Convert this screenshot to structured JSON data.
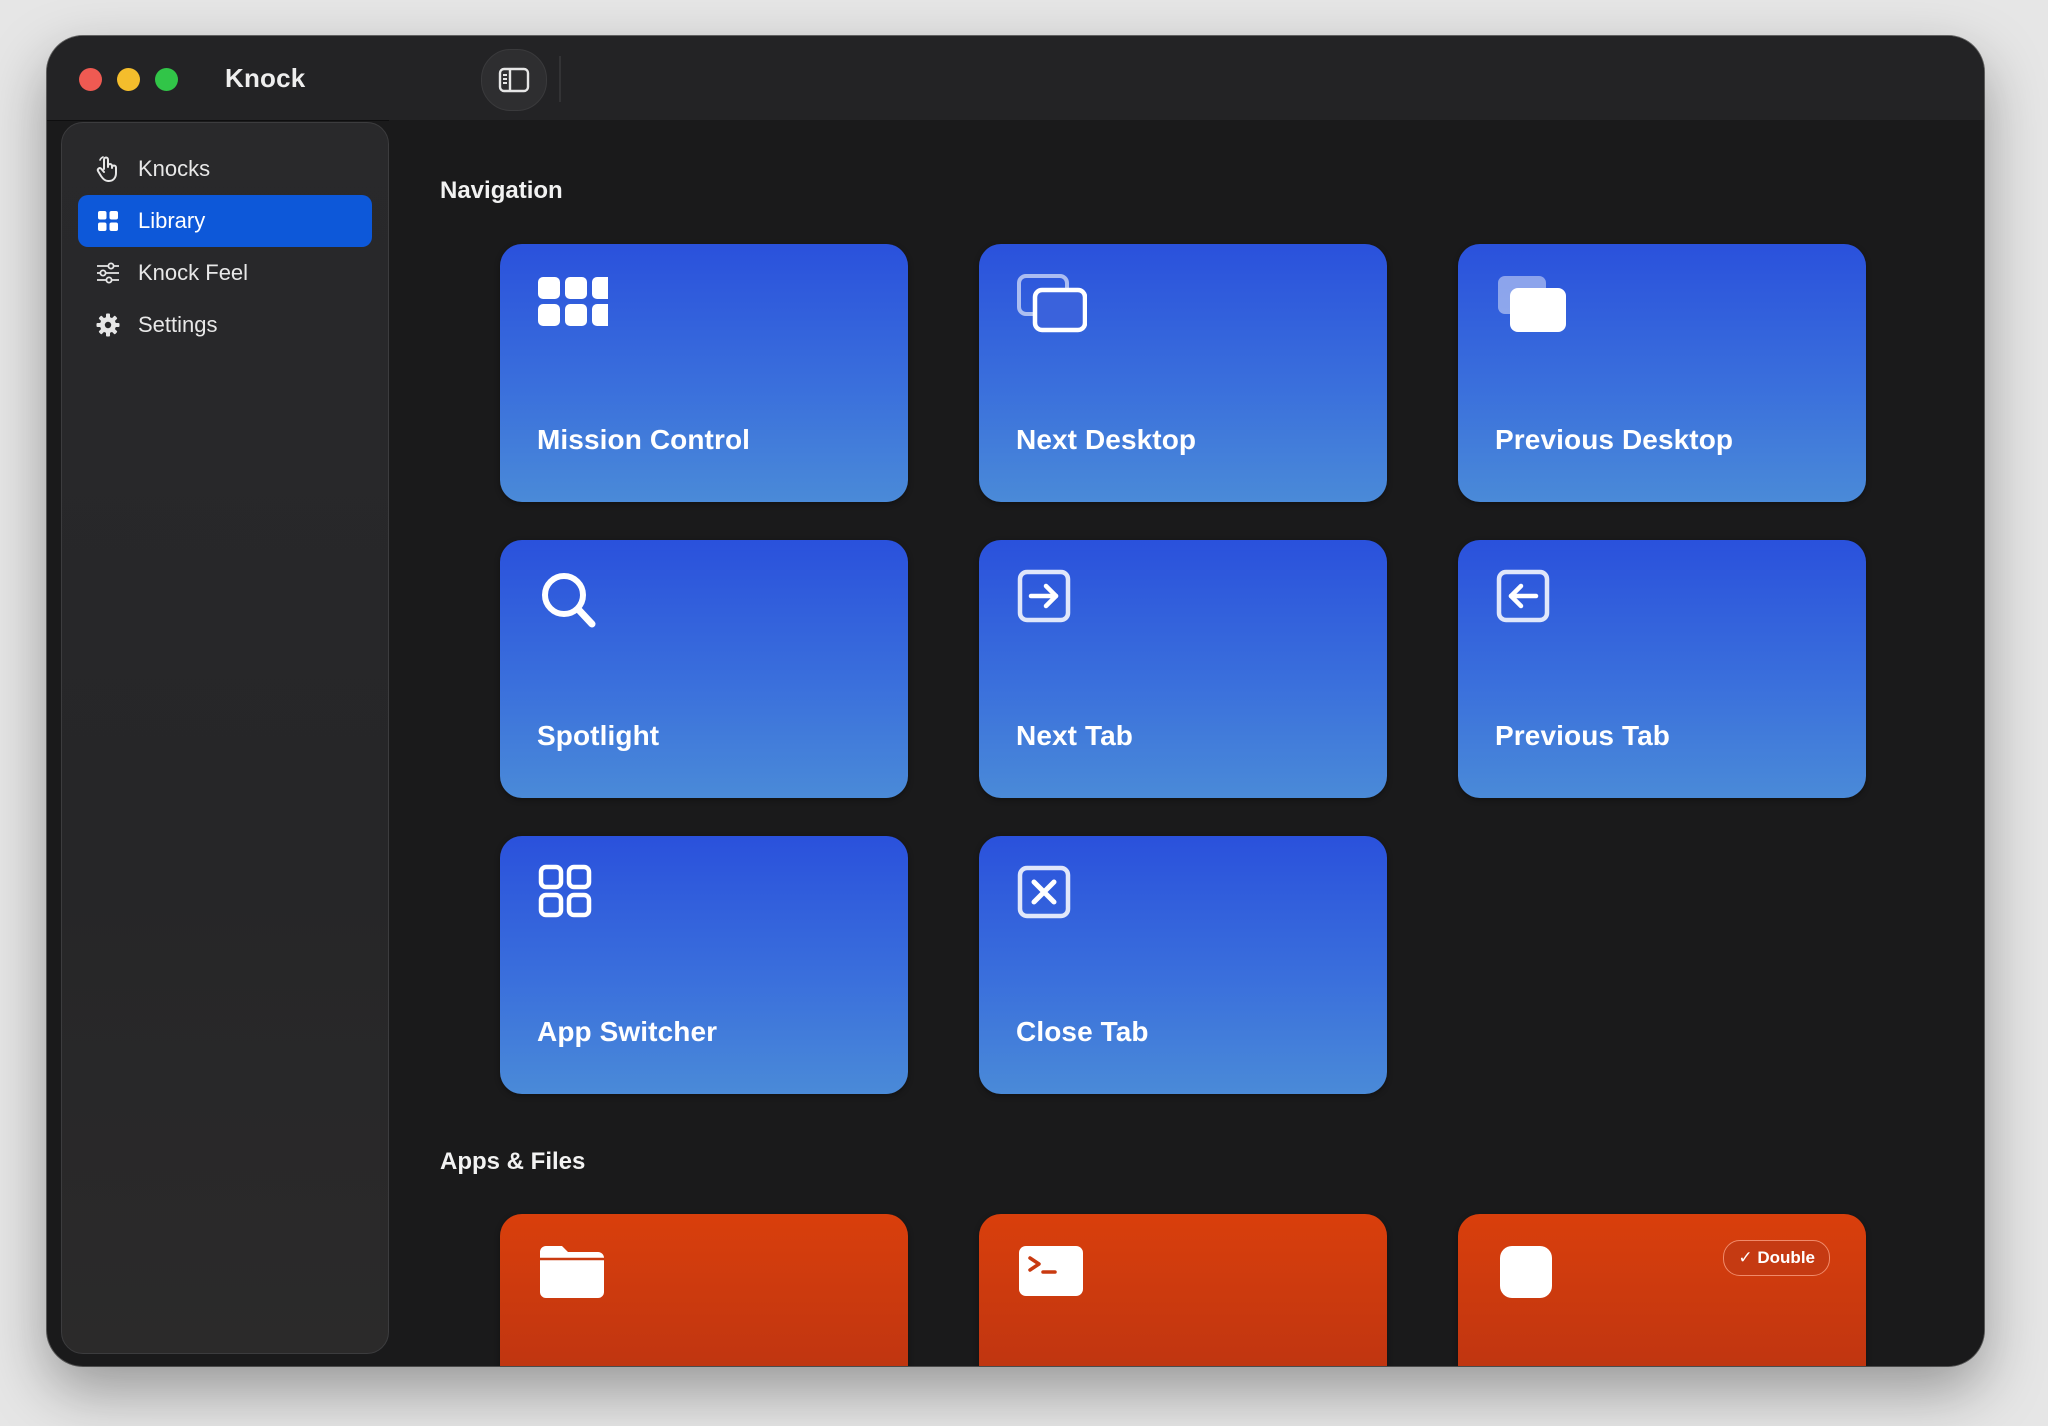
{
  "window": {
    "title": "Knock"
  },
  "colors": {
    "accent": "#0d58d9",
    "card_blue": "#2a51dc",
    "card_orange": "#d93f0c"
  },
  "sidebar": {
    "items": [
      {
        "label": "Knocks",
        "icon": "hand-pointer-icon",
        "active": false
      },
      {
        "label": "Library",
        "icon": "grid-icon",
        "active": true
      },
      {
        "label": "Knock Feel",
        "icon": "sliders-icon",
        "active": false
      },
      {
        "label": "Settings",
        "icon": "gear-icon",
        "active": false
      }
    ]
  },
  "sections": [
    {
      "title": "Navigation",
      "cards": [
        {
          "label": "Mission Control",
          "icon": "mission-control-icon"
        },
        {
          "label": "Next Desktop",
          "icon": "next-desktop-icon"
        },
        {
          "label": "Previous Desktop",
          "icon": "previous-desktop-icon"
        },
        {
          "label": "Spotlight",
          "icon": "magnifier-icon"
        },
        {
          "label": "Next Tab",
          "icon": "arrow-right-square-icon"
        },
        {
          "label": "Previous Tab",
          "icon": "arrow-left-square-icon"
        },
        {
          "label": "App Switcher",
          "icon": "app-grid-icon"
        },
        {
          "label": "Close Tab",
          "icon": "x-square-icon"
        }
      ]
    },
    {
      "title": "Apps & Files",
      "cards": [
        {
          "label": "",
          "icon": "folder-icon"
        },
        {
          "label": "",
          "icon": "terminal-icon"
        },
        {
          "label": "",
          "icon": "app-square-icon",
          "badge": "✓ Double"
        }
      ]
    }
  ]
}
